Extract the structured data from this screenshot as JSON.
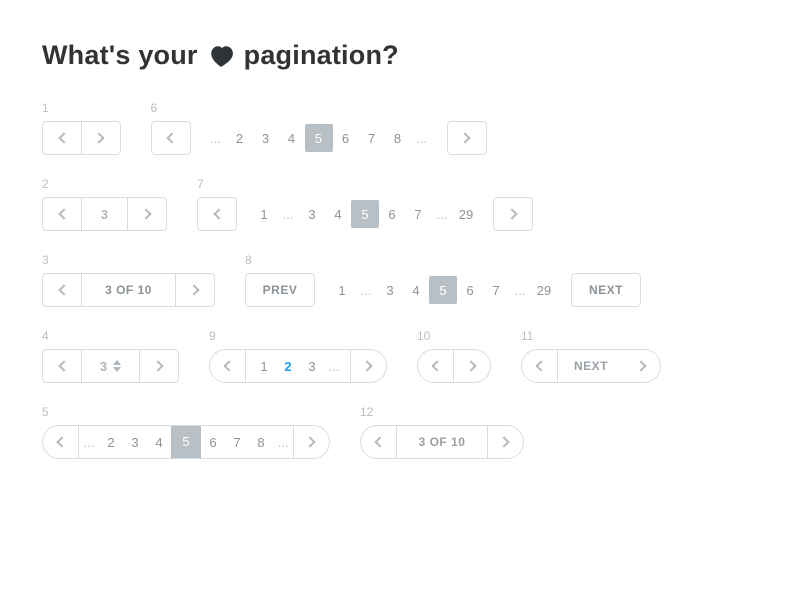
{
  "title_pre": "What's your",
  "title_post": "pagination?",
  "labels": {
    "v1": "1",
    "v2": "2",
    "v3": "3",
    "v4": "4",
    "v5": "5",
    "v6": "6",
    "v7": "7",
    "v8": "8",
    "v9": "9",
    "v10": "10",
    "v11": "11",
    "v12": "12"
  },
  "common": {
    "ellipsis": "...",
    "prev": "PREV",
    "next": "NEXT"
  },
  "v2": {
    "page": "3"
  },
  "v3": {
    "text": "3 OF 10"
  },
  "v4": {
    "page": "3"
  },
  "v5": {
    "pages": [
      "2",
      "3",
      "4",
      "5",
      "6",
      "7",
      "8"
    ],
    "active": "5"
  },
  "v6": {
    "pages": [
      "2",
      "3",
      "4",
      "5",
      "6",
      "7",
      "8"
    ],
    "active": "5"
  },
  "v7": {
    "leading": "1",
    "pages": [
      "3",
      "4",
      "5",
      "6",
      "7"
    ],
    "active": "5",
    "trailing": "29"
  },
  "v8": {
    "leading": "1",
    "pages": [
      "3",
      "4",
      "5",
      "6",
      "7"
    ],
    "active": "5",
    "trailing": "29"
  },
  "v9": {
    "pages": [
      "1",
      "2",
      "3"
    ],
    "active": "2"
  },
  "v12": {
    "text": "3 OF 10"
  }
}
